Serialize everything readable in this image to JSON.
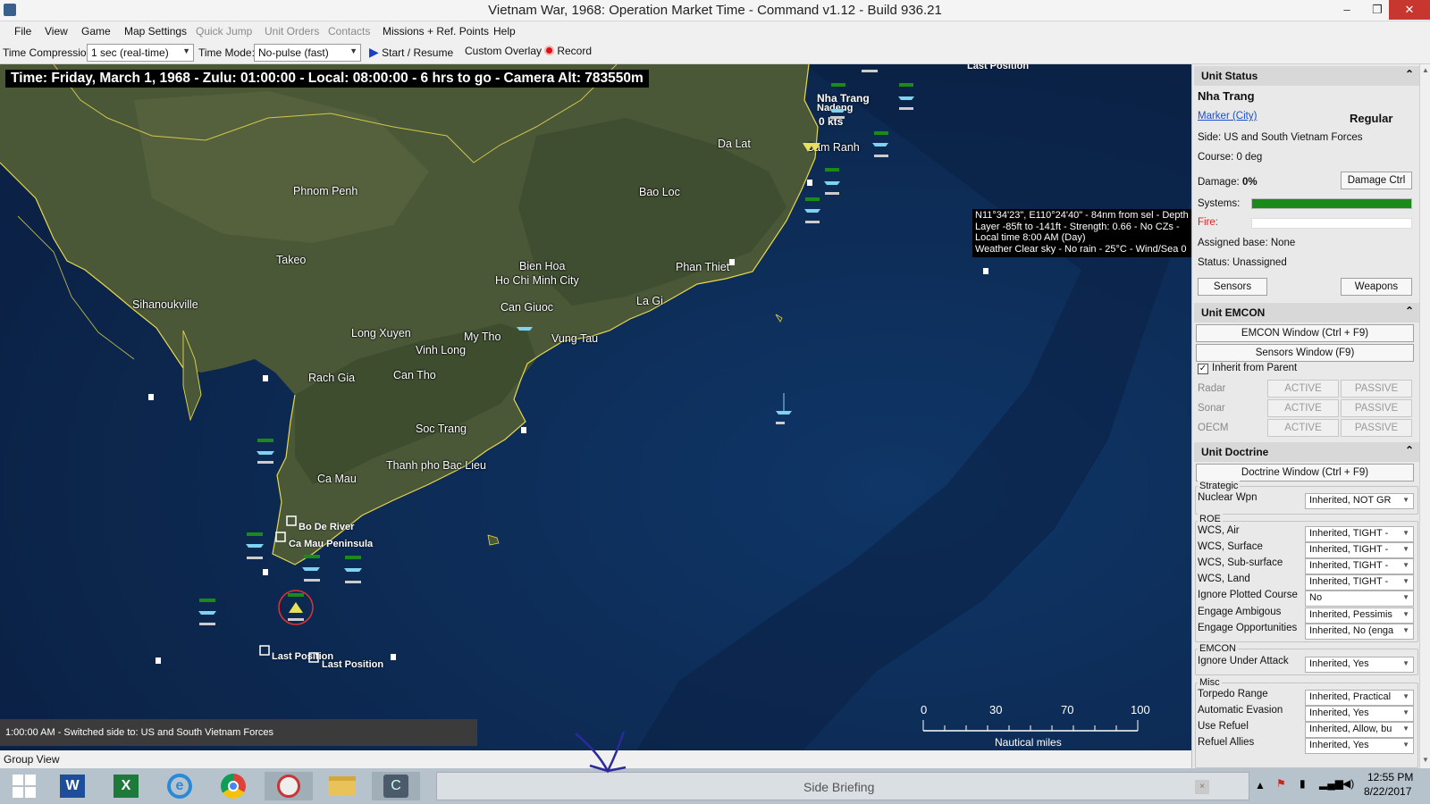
{
  "window": {
    "title": "Vietnam War, 1968: Operation Market Time - Command v1.12 - Build 936.21",
    "minimize": "–",
    "restore": "❐",
    "close": "✕"
  },
  "menu": [
    {
      "label": "File",
      "enabled": true
    },
    {
      "label": "View",
      "enabled": true
    },
    {
      "label": "Game",
      "enabled": true
    },
    {
      "label": "Map Settings",
      "enabled": true
    },
    {
      "label": "Quick Jump",
      "enabled": false
    },
    {
      "label": "Unit Orders",
      "enabled": false
    },
    {
      "label": "Contacts",
      "enabled": false
    },
    {
      "label": "Missions + Ref. Points",
      "enabled": true
    },
    {
      "label": "Help",
      "enabled": true
    }
  ],
  "toolbar": {
    "time_compression_label": "Time Compression:",
    "time_compression_value": "1 sec (real-time)",
    "time_mode_label": "Time Mode:",
    "time_mode_value": "No-pulse (fast)",
    "start_label": "Start / Resume",
    "overlay_label": "Custom Overlay",
    "record_label": "Record"
  },
  "map": {
    "time_banner": "Time: Friday, March 1, 1968 - Zulu: 01:00:00 - Local: 08:00:00 - 6 hrs to go -  Camera Alt: 783550m",
    "cities": [
      {
        "name": "Phnom Penh"
      },
      {
        "name": "Takeo"
      },
      {
        "name": "Sihanoukville"
      },
      {
        "name": "Long Xuyen"
      },
      {
        "name": "Vinh Long"
      },
      {
        "name": "My Tho"
      },
      {
        "name": "Rach Gia"
      },
      {
        "name": "Can Tho"
      },
      {
        "name": "Soc Trang"
      },
      {
        "name": "Ca Mau"
      },
      {
        "name": "Thanh pho Bac Lieu"
      },
      {
        "name": "Bien Hoa"
      },
      {
        "name": "Ho Chi Minh City"
      },
      {
        "name": "Can Giuoc"
      },
      {
        "name": "Vung Tau"
      },
      {
        "name": "La Gi"
      },
      {
        "name": "Phan Thiet"
      },
      {
        "name": "Bao Loc"
      },
      {
        "name": "Da Lat"
      },
      {
        "name": "Cam Ranh"
      }
    ],
    "unit_labels": {
      "nha_trang": "Nha Trang",
      "nha_trang_sub": "Nadeng",
      "speed": "0 kts",
      "last_position_top": "Last Position",
      "bo_de_river": "Bo De River",
      "ca_mau_peninsula": "Ca Mau Peninsula",
      "last_position_1": "Last Position",
      "last_position_2": "Last Position"
    },
    "tooltip": [
      "N11°34'23\", E110°24'40\" - 84nm from sel - Depth -",
      "Layer -85ft to -141ft - Strength: 0.66 - No CZs -",
      "Local time 8:00 AM (Day)",
      "Weather Clear sky - No rain - 25°C - Wind/Sea 0"
    ],
    "message": "1:00:00 AM - Switched side to: US and South Vietnam Forces",
    "scale": {
      "ticks": [
        "0",
        "30",
        "70",
        "100"
      ],
      "unit": "Nautical miles"
    }
  },
  "panel": {
    "unit_status_header": "Unit Status",
    "unit_name": "Nha Trang",
    "unit_type": "Marker (City)",
    "proficiency": "Regular",
    "side": "Side: US and South Vietnam Forces",
    "course": "Course: 0 deg",
    "damage_label": "Damage:",
    "damage_value": "0%",
    "damage_ctrl": "Damage Ctrl",
    "systems_label": "Systems:",
    "systems_level": 1.0,
    "fire_label": "Fire:",
    "fire_level": 0,
    "assigned_base": "Assigned base: None",
    "status": "Status: Unassigned",
    "sensors_btn": "Sensors",
    "weapons_btn": "Weapons",
    "emcon_header": "Unit EMCON",
    "emcon_window": "EMCON Window (Ctrl + F9)",
    "sensors_window": "Sensors Window (F9)",
    "inherit_parent": "Inherit from Parent",
    "inherit_checked": true,
    "emcon_rows": [
      {
        "label": "Radar",
        "active": "ACTIVE",
        "passive": "PASSIVE"
      },
      {
        "label": "Sonar",
        "active": "ACTIVE",
        "passive": "PASSIVE"
      },
      {
        "label": "OECM",
        "active": "ACTIVE",
        "passive": "PASSIVE"
      }
    ],
    "doctrine_header": "Unit Doctrine",
    "doctrine_window": "Doctrine Window (Ctrl + F9)",
    "strategic_group": "Strategic",
    "nuclear": {
      "label": "Nuclear Wpn",
      "value": "Inherited, NOT GR"
    },
    "roe_group": "ROE",
    "roe_rows": [
      {
        "label": "WCS, Air",
        "value": "Inherited, TIGHT -"
      },
      {
        "label": "WCS, Surface",
        "value": "Inherited, TIGHT -"
      },
      {
        "label": "WCS, Sub-surface",
        "value": "Inherited, TIGHT -"
      },
      {
        "label": "WCS, Land",
        "value": "Inherited, TIGHT -"
      },
      {
        "label": "Ignore Plotted Course",
        "value": "No"
      },
      {
        "label": "Engage Ambigous",
        "value": "Inherited, Pessimis"
      },
      {
        "label": "Engage Opportunities",
        "value": "Inherited, No (enga"
      }
    ],
    "emcon_group": "EMCON",
    "ignore_under_attack": {
      "label": "Ignore Under Attack",
      "value": "Inherited, Yes"
    },
    "misc_group": "Misc",
    "misc_rows": [
      {
        "label": "Torpedo Range",
        "value": "Inherited, Practical"
      },
      {
        "label": "Automatic Evasion",
        "value": "Inherited, Yes"
      },
      {
        "label": "Use Refuel",
        "value": "Inherited, Allow, bu"
      },
      {
        "label": "Refuel Allies",
        "value": "Inherited, Yes"
      }
    ]
  },
  "group_view": "Group View",
  "taskbar": {
    "apps": [
      "windows-logo-icon",
      "word-icon",
      "excel-icon",
      "ie-icon",
      "chrome-icon",
      "snipping-icon",
      "explorer-icon",
      "command-app-icon"
    ],
    "search_text": "Side Briefing",
    "time": "12:55 PM",
    "date": "8/22/2017"
  },
  "colors": {
    "map_bg": "#0d2546",
    "land": "#4c5a3a",
    "coast": "#e6d84c",
    "ok_green": "#1a8a1a",
    "unit_blue": "#7fd3f2",
    "link_blue": "#1a4fd0"
  }
}
